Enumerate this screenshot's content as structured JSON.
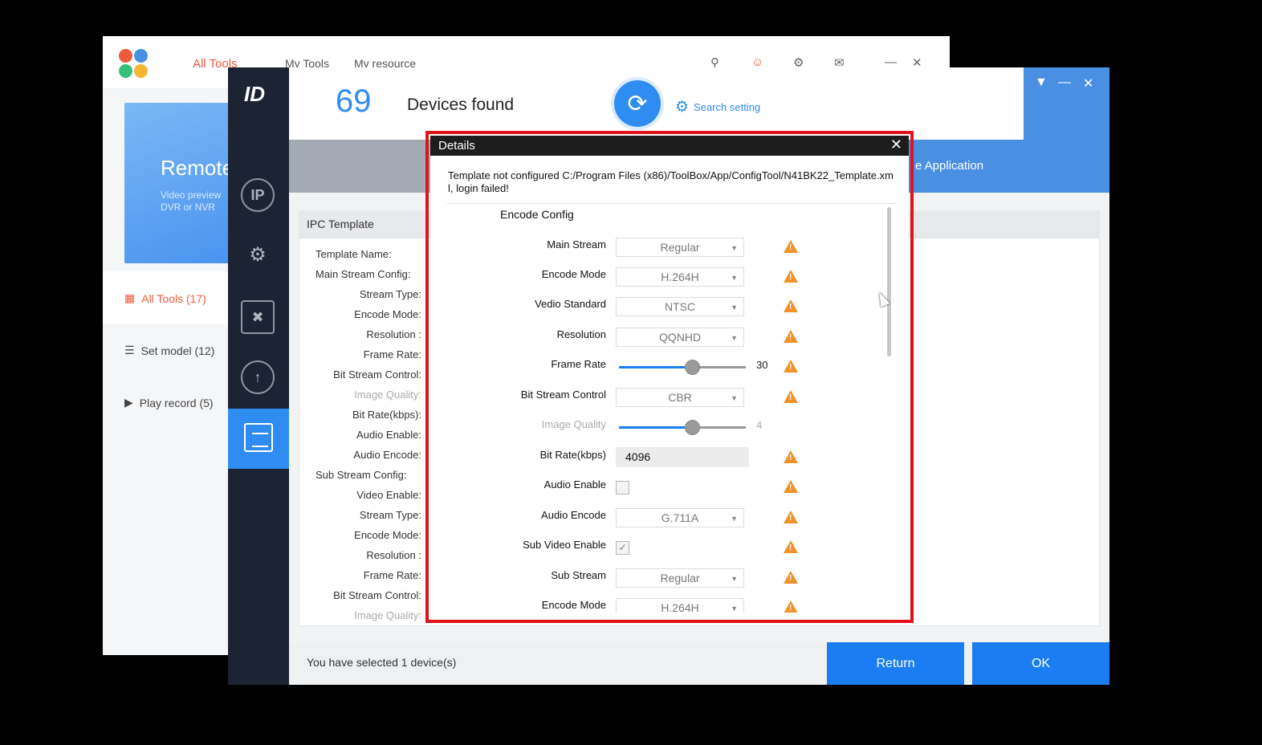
{
  "toolbox": {
    "tabs": [
      "All Tools",
      "My Tools",
      "My resource"
    ],
    "banner_title": "Remote",
    "banner_sub": "Video preview DVR or NVR",
    "menu": [
      {
        "label": "All Tools (17)",
        "icon": "grid-icon"
      },
      {
        "label": "Set model (12)",
        "icon": "sliders-icon"
      },
      {
        "label": "Play record (5)",
        "icon": "play-icon"
      }
    ]
  },
  "config": {
    "device_count": "69",
    "devices_found": "Devices found",
    "search_setting": "Search setting",
    "bar_text": "e Application",
    "ipc_template": "IPC Template",
    "ipc_labels": [
      "Template Name:",
      "Main Stream Config:",
      "Stream Type:",
      "Encode Mode:",
      "Resolution :",
      "Frame Rate:",
      "Bit Stream Control:",
      "Image Quality:",
      "Bit Rate(kbps):",
      "Audio Enable:",
      "Audio Encode:",
      "Sub Stream Config:",
      "Video Enable:",
      "Stream Type:",
      "Encode Mode:",
      "Resolution :",
      "Frame Rate:",
      "Bit Stream Control:",
      "Image Quality:"
    ],
    "selected_text": "You have selected 1 device(s)",
    "return_label": "Return",
    "ok_label": "OK"
  },
  "details": {
    "title": "Details",
    "message": "Template not configured C:/Program Files (x86)/ToolBox/App/ConfigTool/N41BK22_Template.xml, login failed!",
    "section": "Encode Config",
    "fields": {
      "main_stream": {
        "label": "Main Stream",
        "value": "Regular"
      },
      "encode_mode": {
        "label": "Encode Mode",
        "value": "H.264H"
      },
      "video_standard": {
        "label": "Vedio Standard",
        "value": "NTSC"
      },
      "resolution": {
        "label": "Resolution",
        "value": "QQNHD"
      },
      "frame_rate": {
        "label": "Frame Rate",
        "value": "30",
        "fraction": 0.58
      },
      "bit_stream_control": {
        "label": "Bit Stream Control",
        "value": "CBR"
      },
      "image_quality": {
        "label": "Image Quality",
        "value": "4",
        "fraction": 0.58
      },
      "bit_rate": {
        "label": "Bit Rate(kbps)",
        "value": "4096"
      },
      "audio_enable": {
        "label": "Audio Enable",
        "checked": false
      },
      "audio_encode": {
        "label": "Audio Encode",
        "value": "G.711A"
      },
      "sub_video_enable": {
        "label": "Sub Video Enable",
        "checked": true
      },
      "sub_stream": {
        "label": "Sub Stream",
        "value": "Regular"
      },
      "sub_encode_mode": {
        "label": "Encode Mode",
        "value": "H.264H"
      }
    }
  },
  "colors": {
    "accent": "#2f8cf0",
    "highlight_border": "#e0121a",
    "warning": "#f0912a"
  }
}
